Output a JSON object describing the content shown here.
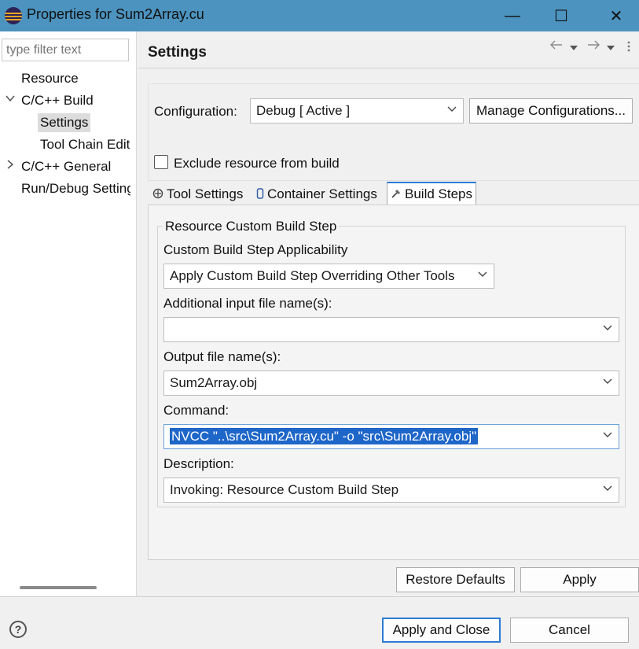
{
  "window": {
    "title": "Properties for Sum2Array.cu",
    "controls": {
      "minimize": "—",
      "maximize": "☐",
      "close": "✕"
    }
  },
  "left_pane": {
    "filter_placeholder": "type filter text",
    "tree": [
      {
        "label": "Resource",
        "expander": ""
      },
      {
        "label": "C/C++ Build",
        "expander": "expanded"
      },
      {
        "label": "Settings",
        "expander": "",
        "selected": true
      },
      {
        "label": "Tool Chain Editor",
        "expander": ""
      },
      {
        "label": "C/C++ General",
        "expander": "collapsed"
      },
      {
        "label": "Run/Debug Settings",
        "expander": ""
      }
    ]
  },
  "page": {
    "title": "Settings",
    "configuration_label": "Configuration:",
    "configuration_value": "Debug  [ Active ]",
    "manage_button": "Manage Configurations...",
    "exclude_label": "Exclude resource from build",
    "exclude_checked": false
  },
  "tabs": [
    {
      "label": "Tool Settings",
      "icon": "tool-settings-icon",
      "active": false
    },
    {
      "label": "Container Settings",
      "icon": "container-icon",
      "active": false
    },
    {
      "label": "Build Steps",
      "icon": "build-steps-icon",
      "active": true
    }
  ],
  "build_steps": {
    "group_title": "Resource Custom Build Step",
    "applicability_label": "Custom Build Step Applicability",
    "applicability_value": "Apply Custom Build Step Overriding Other Tools",
    "input_label": "Additional input file name(s):",
    "input_value": "",
    "output_label": "Output file name(s):",
    "output_value": "Sum2Array.obj",
    "command_label": "Command:",
    "command_value": "NVCC \"..\\src\\Sum2Array.cu\" -o \"src\\Sum2Array.obj\"",
    "description_label": "Description:",
    "description_value": "Invoking: Resource Custom Build Step"
  },
  "buttons": {
    "restore_defaults": "Restore Defaults",
    "apply": "Apply",
    "apply_and_close": "Apply and Close",
    "cancel": "Cancel",
    "help": "?"
  },
  "colors": {
    "titlebar": "#4c93bf",
    "accent": "#2c7cd4",
    "selection": "#1e66c8"
  }
}
